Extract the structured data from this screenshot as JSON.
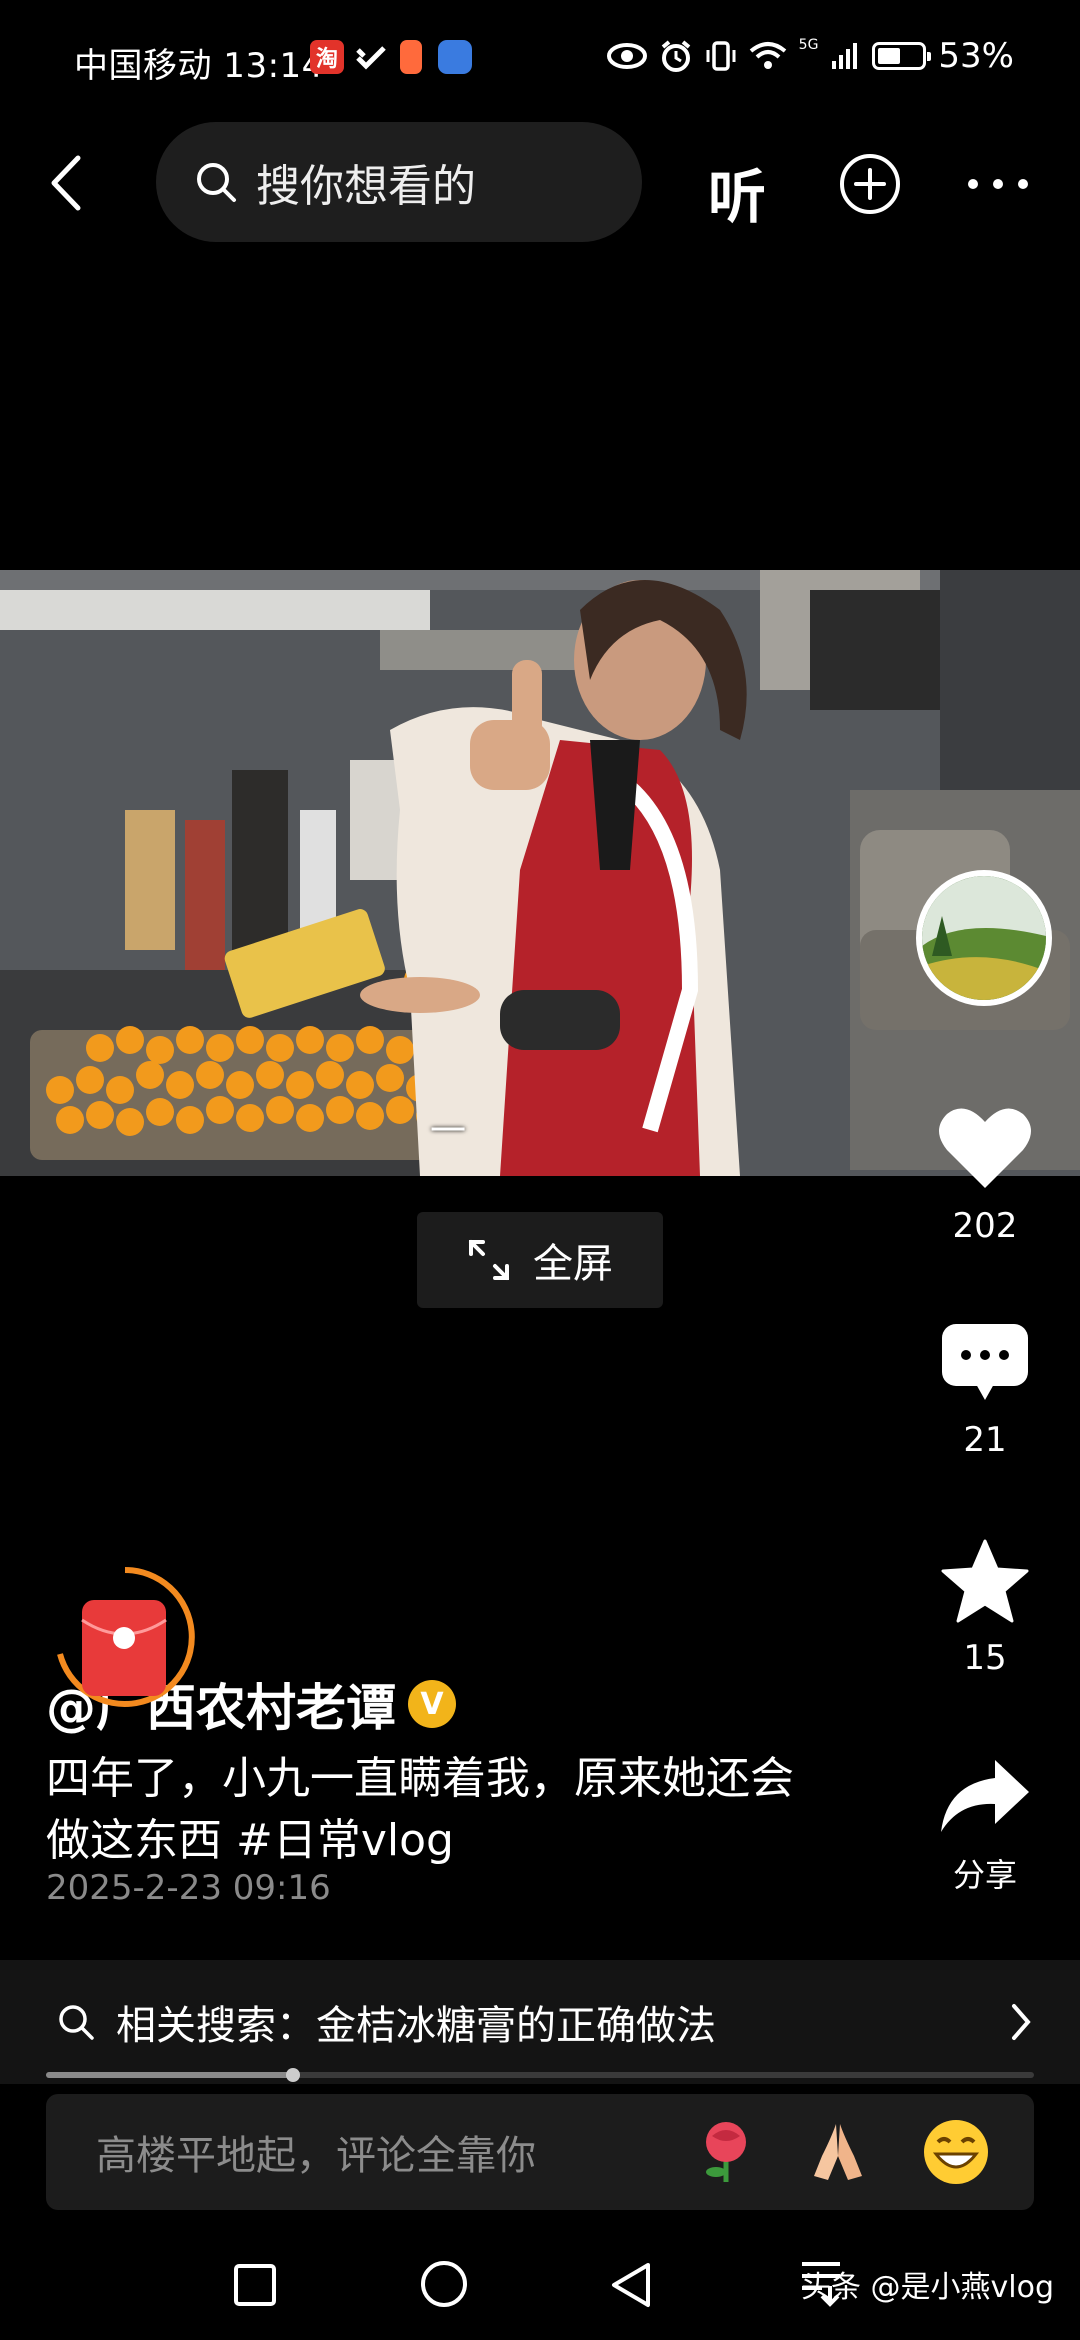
{
  "status_bar": {
    "carrier_time": "中国移动 13:14",
    "badge_taobao": "淘",
    "signal_label": "5G",
    "battery": "53%",
    "battery_level": 0.53
  },
  "header": {
    "search_placeholder": "搜你想看的",
    "listen_label": "听"
  },
  "video": {
    "subtitle": "一"
  },
  "fullscreen_label": "全屏",
  "actions": {
    "likes": "202",
    "comments": "21",
    "favorites": "15",
    "share_label": "分享"
  },
  "post": {
    "author": "@广西农村老谭",
    "verified_mark": "V",
    "caption_line1": "四年了，小九一直瞒着我，原来她还会",
    "caption_line2": "做这东西 #日常vlog",
    "datetime": "2025-2-23 09:16"
  },
  "related": {
    "text": "相关搜索：金桔冰糖膏的正确做法"
  },
  "playback_progress": 0.25,
  "comment": {
    "placeholder": "高楼平地起，评论全靠你"
  },
  "watermark": "头条 @是小燕vlog",
  "icons": [
    "back-icon",
    "search-icon",
    "add-icon",
    "more-icon",
    "like-icon",
    "comment-icon",
    "star-icon",
    "share-icon",
    "rose-emoji",
    "pray-emoji",
    "grin-emoji",
    "square-nav-icon",
    "circle-nav-icon",
    "triangle-nav-icon"
  ]
}
